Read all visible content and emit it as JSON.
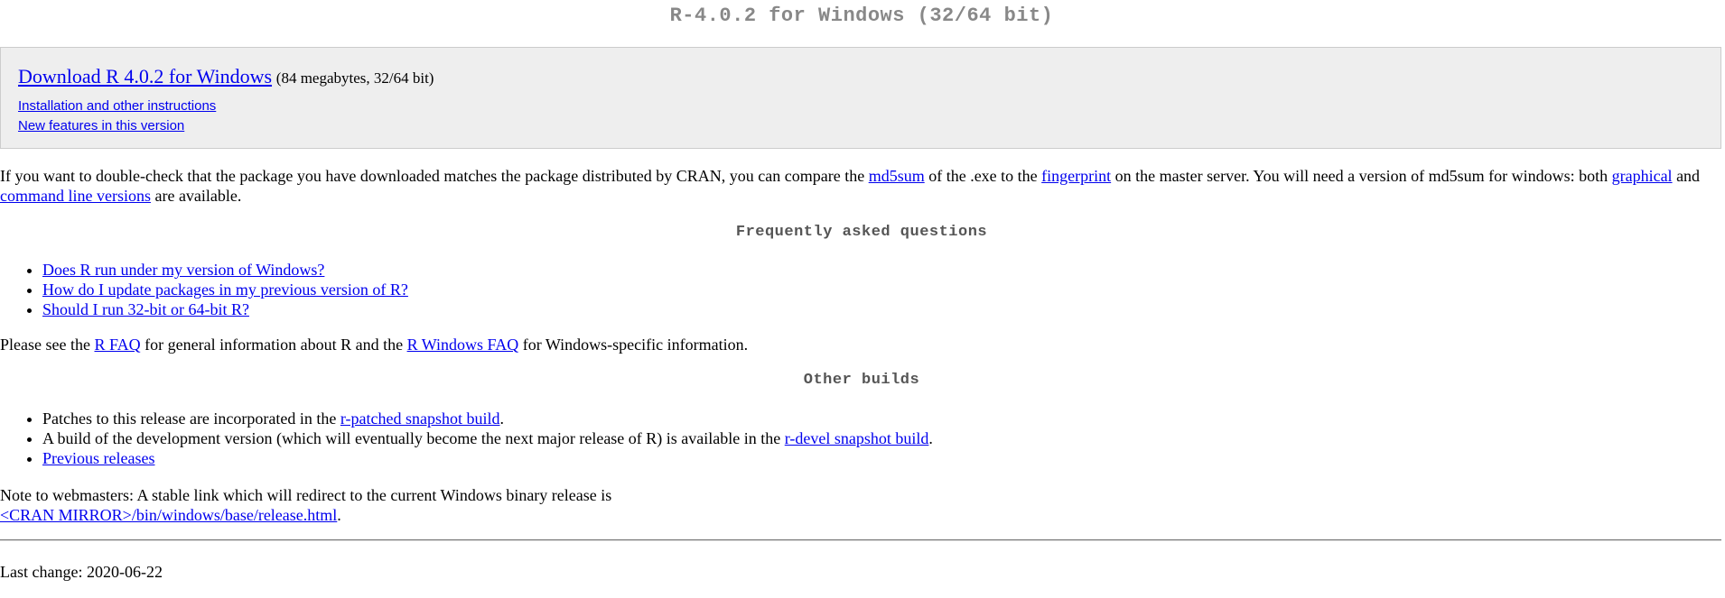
{
  "title": "R-4.0.2 for Windows (32/64 bit)",
  "download_box": {
    "main_link": "Download R 4.0.2 for Windows",
    "size_note": "(84 megabytes, 32/64 bit)",
    "links": [
      "Installation and other instructions",
      "New features in this version"
    ]
  },
  "verify_paragraph": {
    "t1": "If you want to double-check that the package you have downloaded matches the package distributed by CRAN, you can compare the ",
    "md5sum_link": "md5sum",
    "t2": " of the .exe to the ",
    "fingerprint_link": "fingerprint",
    "t3": " on the master server. You will need a version of md5sum for windows: both ",
    "graphical_link": "graphical",
    "t4": " and ",
    "cmdline_link": "command line versions",
    "t5": " are available."
  },
  "faq": {
    "heading": "Frequently asked questions",
    "items": [
      "Does R run under my version of Windows?",
      "How do I update packages in my previous version of R?",
      "Should I run 32-bit or 64-bit R?"
    ]
  },
  "faq_paragraph": {
    "t1": "Please see the ",
    "rfaq_link": "R FAQ",
    "t2": " for general information about R and the ",
    "rwinfaq_link": "R Windows FAQ",
    "t3": " for Windows-specific information."
  },
  "other_builds": {
    "heading": "Other builds",
    "item1_text": "Patches to this release are incorporated in the ",
    "item1_link": "r-patched snapshot build",
    "item1_end": ".",
    "item2_text": "A build of the development version (which will eventually become the next major release of R) is available in the ",
    "item2_link": "r-devel snapshot build",
    "item2_end": ".",
    "item3_link": "Previous releases"
  },
  "webmasters": {
    "text": "Note to webmasters: A stable link which will redirect to the current Windows binary release is",
    "link": "<CRAN MIRROR>/bin/windows/base/release.html",
    "end": "."
  },
  "footer": {
    "last_change": "Last change: 2020-06-22"
  }
}
